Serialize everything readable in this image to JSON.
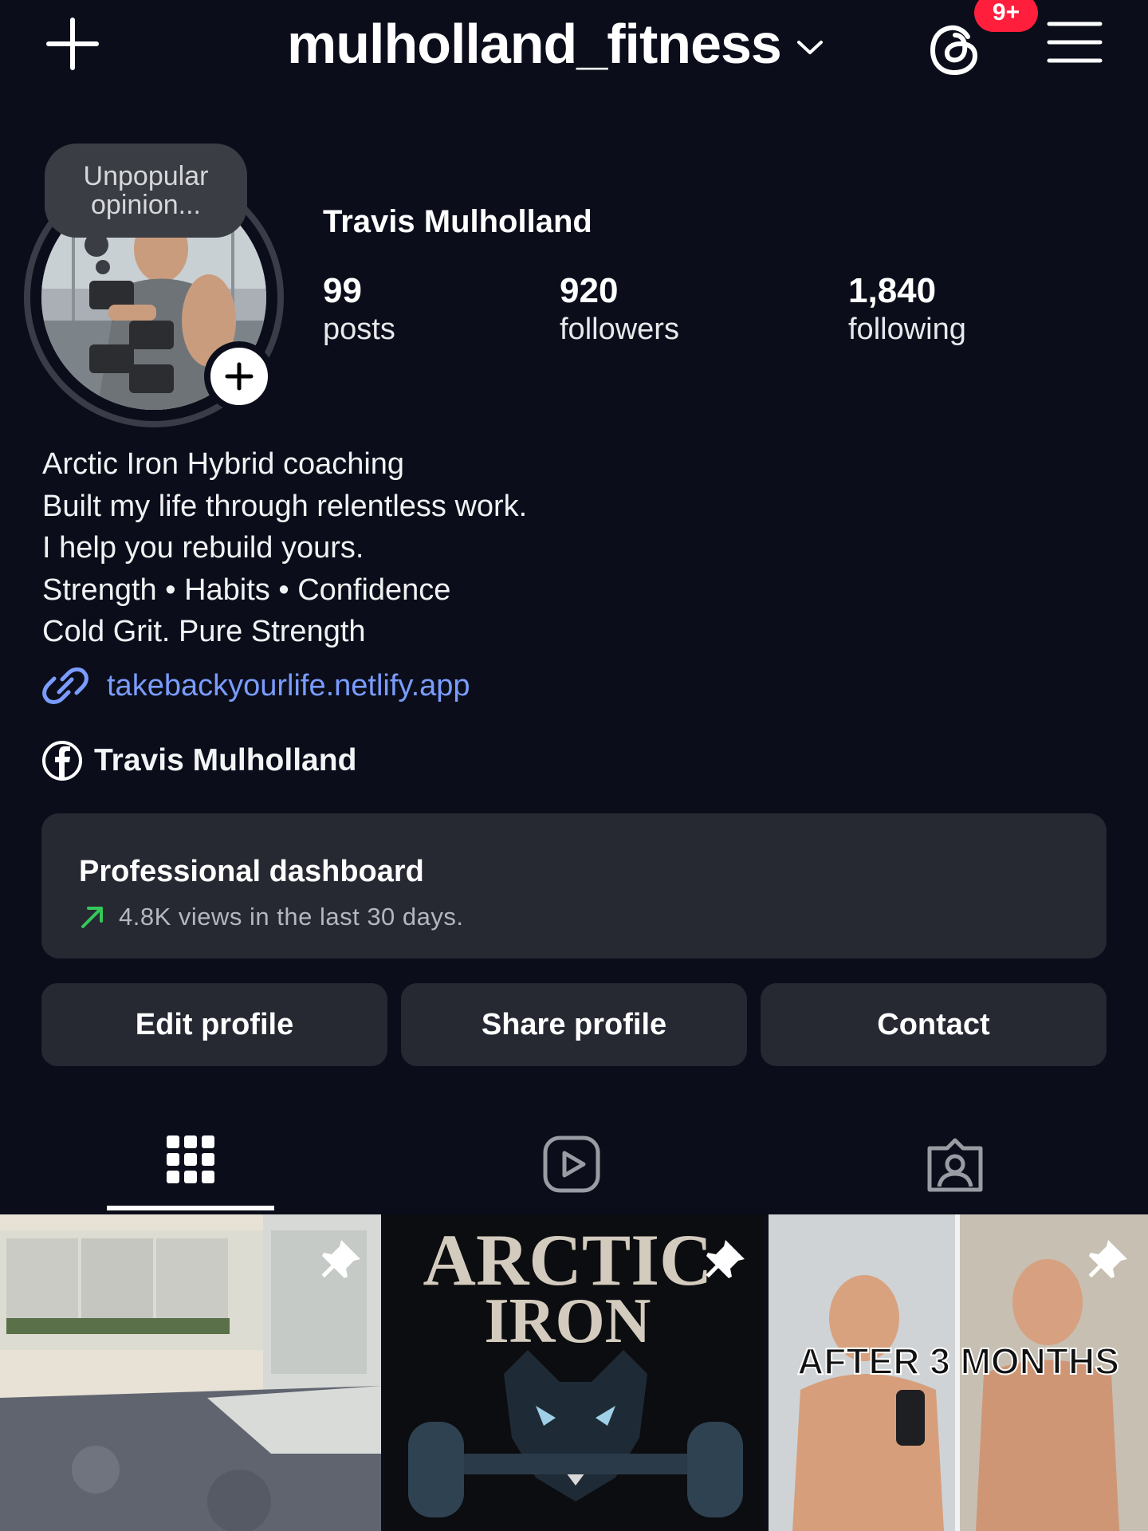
{
  "header": {
    "username": "mulholland_fitness",
    "notification_badge": "9+",
    "badge_color": "#ff1e3c"
  },
  "profile": {
    "note_line1": "Unpopular",
    "note_line2": "opinion...",
    "display_name": "Travis Mulholland",
    "stats": {
      "posts_count": "99",
      "posts_label": "posts",
      "followers_count": "920",
      "followers_label": "followers",
      "following_count": "1,840",
      "following_label": "following"
    },
    "bio": [
      "Arctic Iron Hybrid coaching",
      "Built my life through relentless work.",
      "I help you rebuild yours.",
      "Strength • Habits • Confidence",
      "Cold Grit. Pure Strength"
    ],
    "link": "takebackyourlife.netlify.app",
    "link_color": "#7a9cff",
    "facebook_name": "Travis Mulholland"
  },
  "dashboard": {
    "title": "Professional dashboard",
    "subtitle": "4.8K views in the last 30 days.",
    "trend_color": "#34c759"
  },
  "actions": {
    "edit": "Edit profile",
    "share": "Share profile",
    "contact": "Contact"
  },
  "tabs": {
    "icons": [
      "grid-icon",
      "reels-icon",
      "tagged-icon"
    ],
    "active": "grid"
  },
  "posts": {
    "post2_line1": "ARCTIC",
    "post2_line2": "IRON",
    "post3_caption": "AFTER 3 MONTHS"
  }
}
